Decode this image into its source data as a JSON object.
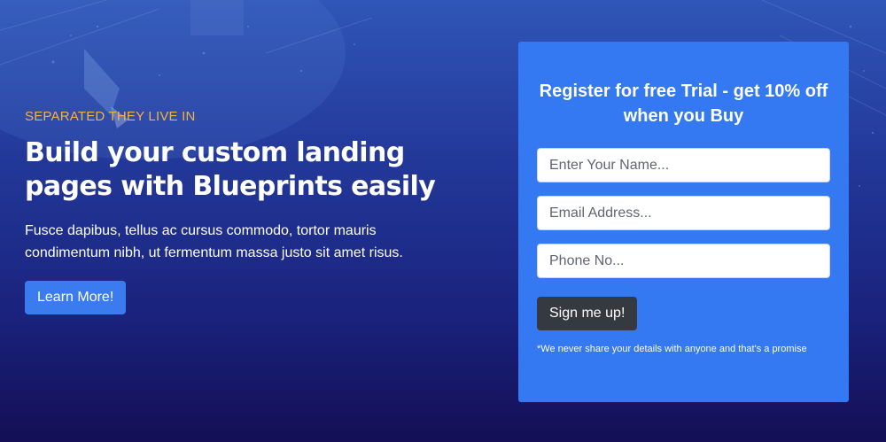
{
  "hero": {
    "eyebrow": "SEPARATED THEY LIVE IN",
    "headline": "Build your custom landing pages with Blueprints easily",
    "description": "Fusce dapibus, tellus ac cursus commodo, tortor mauris condimentum nibh, ut fermentum massa justo sit amet risus.",
    "cta_label": "Learn More!"
  },
  "form": {
    "title": "Register for free Trial - get 10% off when you Buy",
    "name_placeholder": "Enter Your Name...",
    "email_placeholder": "Email Address...",
    "phone_placeholder": "Phone No...",
    "submit_label": "Sign me up!",
    "note": "*We never share your details with anyone and that's a promise"
  },
  "colors": {
    "eyebrow": "#f2b43f",
    "cta": "#3a7bf0",
    "form_card": "#3478f2",
    "submit": "#343a40",
    "background_top": "#2f56b8",
    "background_bottom": "#140f55"
  }
}
